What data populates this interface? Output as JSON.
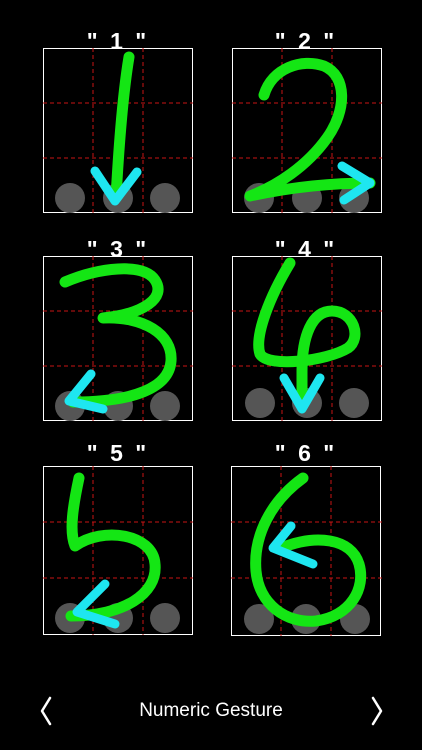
{
  "gestures": [
    {
      "title": "\" 1 \"",
      "digit": "1"
    },
    {
      "title": "\" 2 \"",
      "digit": "2"
    },
    {
      "title": "\" 3 \"",
      "digit": "3"
    },
    {
      "title": "\" 4 \"",
      "digit": "4"
    },
    {
      "title": "\" 5 \"",
      "digit": "5"
    },
    {
      "title": "\" 6 \"",
      "digit": "6"
    }
  ],
  "bottom_bar": {
    "title": "Numeric Gesture",
    "prev_icon": "chevron-left-icon",
    "next_icon": "chevron-right-icon"
  },
  "colors": {
    "background": "#000000",
    "stroke": "#14e614",
    "arrow": "#1ee6f0",
    "grid": "#c81414",
    "button": "#555555",
    "border": "#ffffff"
  }
}
